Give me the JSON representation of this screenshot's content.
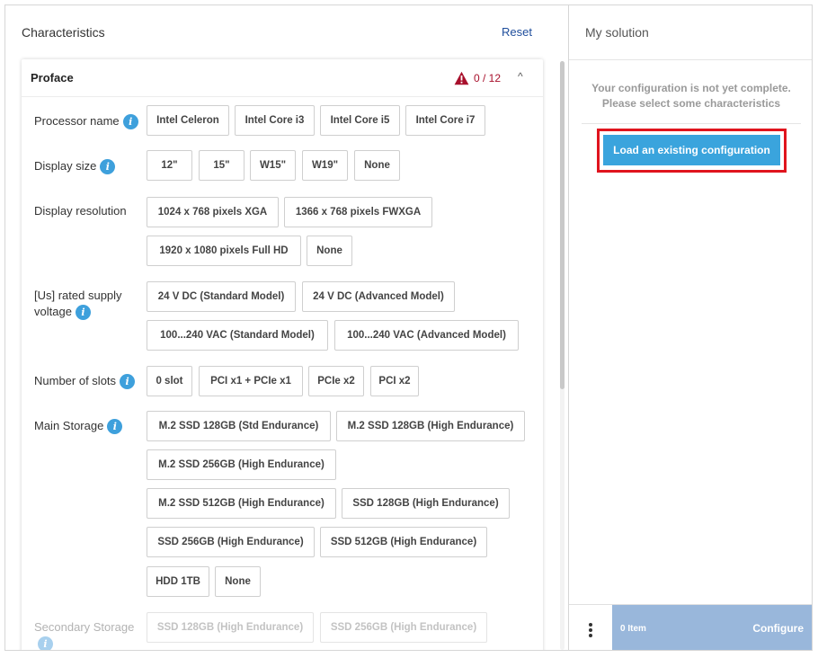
{
  "left_panel": {
    "title": "Characteristics",
    "reset_label": "Reset"
  },
  "card": {
    "title": "Proface",
    "status_count": "0 / 12",
    "collapse_icon": "^"
  },
  "characteristics": [
    {
      "label": "Processor name",
      "options": [
        "Intel Celeron",
        "Intel Core i3",
        "Intel Core i5",
        "Intel Core i7"
      ]
    },
    {
      "label": "Display size",
      "options": [
        "12\"",
        "15\"",
        "W15\"",
        "W19\"",
        "None"
      ]
    },
    {
      "label": "Display resolution",
      "options": [
        "1024 x 768 pixels XGA",
        "1366 x 768 pixels FWXGA",
        "1920 x 1080 pixels Full HD",
        "None"
      ]
    },
    {
      "label_line1": "[Us] rated supply",
      "label_line2": "voltage",
      "options": [
        "24 V DC (Standard Model)",
        "24 V DC (Advanced Model)",
        "100...240 VAC (Standard Model)",
        "100...240 VAC (Advanced Model)"
      ]
    },
    {
      "label": "Number of slots",
      "options": [
        "0 slot",
        "PCI x1 + PCIe x1",
        "PCIe x2",
        "PCI x2"
      ]
    },
    {
      "label": "Main Storage",
      "options": [
        "M.2 SSD 128GB (Std Endurance)",
        "M.2 SSD 128GB (High Endurance)",
        "M.2 SSD 256GB (High Endurance)",
        "M.2 SSD 512GB (High Endurance)",
        "SSD 128GB (High Endurance)",
        "SSD 256GB (High Endurance)",
        "SSD 512GB (High Endurance)",
        "HDD 1TB",
        "None"
      ]
    },
    {
      "label": "Secondary Storage",
      "options": [
        "SSD 128GB (High Endurance)",
        "SSD 256GB (High Endurance)"
      ]
    }
  ],
  "right_panel": {
    "title": "My solution",
    "incomplete_line1": "Your configuration is not yet complete.",
    "incomplete_line2": "Please select some characteristics",
    "load_button": "Load an existing configuration",
    "item_count": "0 Item",
    "configure_label": "Configure"
  },
  "colors": {
    "accent": "#3aa4dd",
    "link": "#1f4e9c",
    "warning": "#a8102c",
    "highlight": "#e0141e",
    "footer": "#99b7db"
  },
  "icons": {
    "info": "info-icon",
    "warning": "warning-triangle-icon",
    "collapse": "chevron-up-icon",
    "menu": "kebab-menu-icon"
  }
}
